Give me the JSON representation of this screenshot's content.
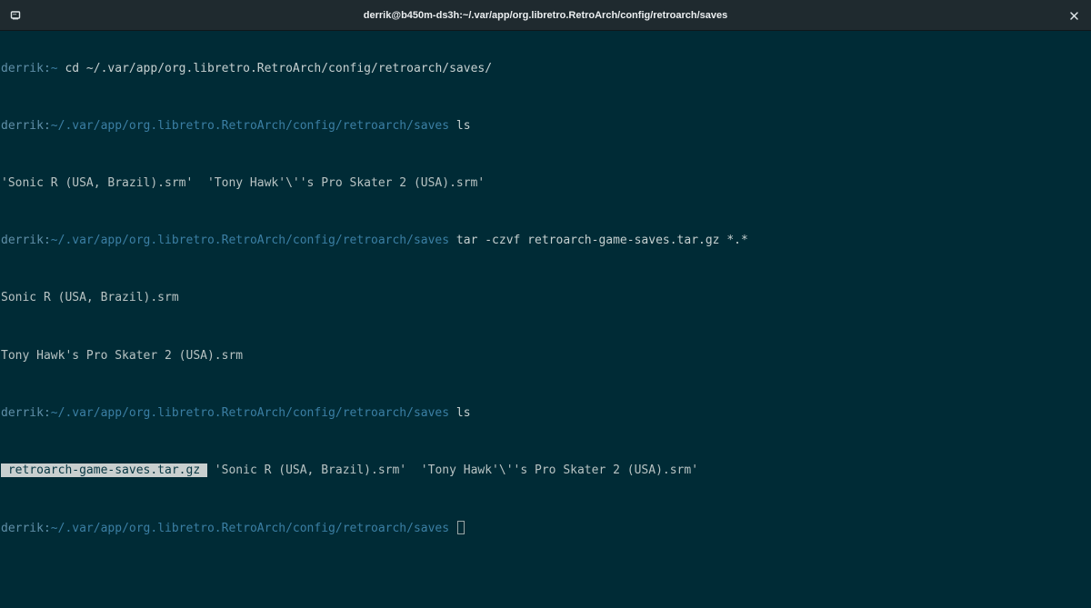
{
  "window": {
    "title": "derrik@b450m-ds3h:~/.var/app/org.libretro.RetroArch/config/retroarch/saves",
    "menu_icon": "terminal-menu-icon",
    "close_icon": "close-icon"
  },
  "terminal": {
    "prompt_user": "derrik",
    "prompt_sep": ":",
    "lines": [
      {
        "path": "~",
        "cmd": " cd ~/.var/app/org.libretro.RetroArch/config/retroarch/saves/"
      },
      {
        "path": "~/.var/app/org.libretro.RetroArch/config/retroarch/saves",
        "cmd": " ls"
      },
      {
        "out": "'Sonic R (USA, Brazil).srm'  'Tony Hawk'\\''s Pro Skater 2 (USA).srm'"
      },
      {
        "path": "~/.var/app/org.libretro.RetroArch/config/retroarch/saves",
        "cmd": " tar -czvf retroarch-game-saves.tar.gz *.*"
      },
      {
        "out": "Sonic R (USA, Brazil).srm"
      },
      {
        "out": "Tony Hawk's Pro Skater 2 (USA).srm"
      },
      {
        "path": "~/.var/app/org.libretro.RetroArch/config/retroarch/saves",
        "cmd": " ls"
      },
      {
        "highlight": " retroarch-game-saves.tar.gz ",
        "out": " 'Sonic R (USA, Brazil).srm'  'Tony Hawk'\\''s Pro Skater 2 (USA).srm'"
      },
      {
        "path": "~/.var/app/org.libretro.RetroArch/config/retroarch/saves",
        "cmd": " "
      }
    ]
  },
  "colors": {
    "background": "#002b36",
    "titlebar": "#1f2a2f",
    "prompt": "#5f8fa8",
    "path": "#3b7fa4",
    "text": "#b8c3c3"
  }
}
